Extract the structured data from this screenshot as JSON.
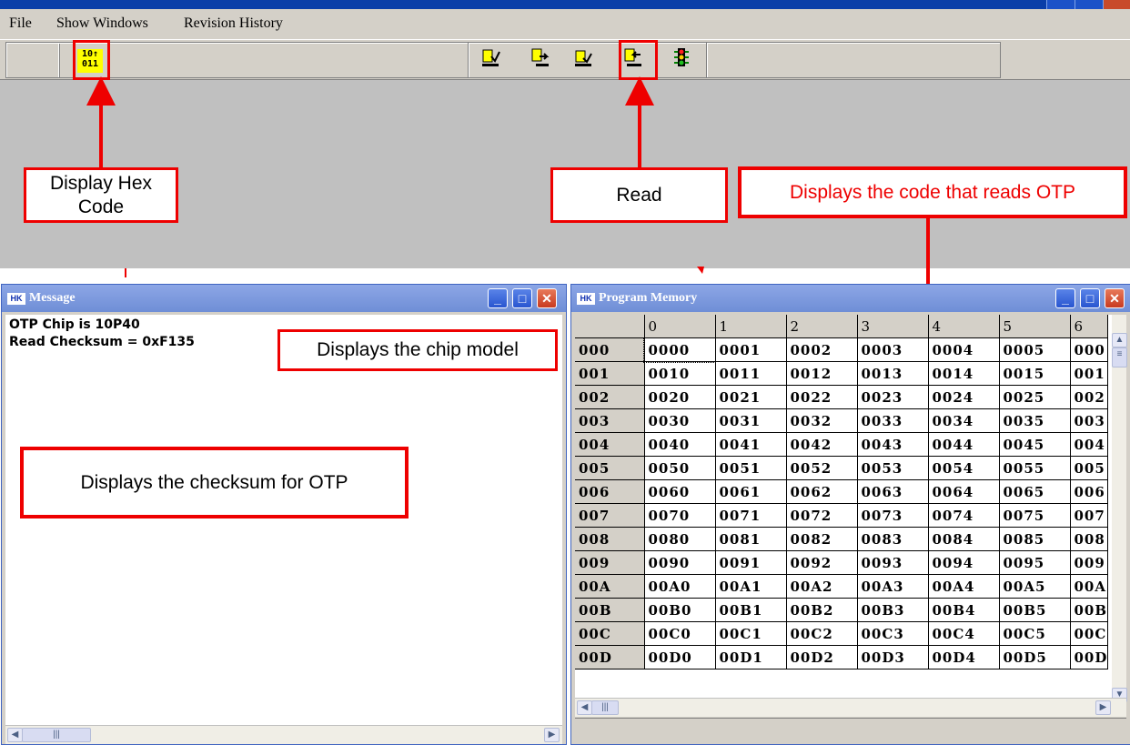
{
  "menu": {
    "file": "File",
    "show_windows": "Show Windows",
    "revision_history": "Revision History"
  },
  "toolbar": {
    "hex_icon_text": [
      "10↑",
      "011"
    ]
  },
  "annotations": {
    "display_hex_code": "Display Hex Code",
    "read": "Read",
    "reads_otp": "Displays the code that reads OTP",
    "chip_model": "Displays the chip model",
    "checksum": "Displays the checksum for OTP"
  },
  "message_window": {
    "title": "Message",
    "line1": "OTP Chip is 10P40",
    "line2": "Read Checksum = 0xF135"
  },
  "program_memory": {
    "title": "Program Memory",
    "columns": [
      "0",
      "1",
      "2",
      "3",
      "4",
      "5",
      "6"
    ],
    "rows": [
      {
        "addr": "000",
        "cells": [
          "0000",
          "0001",
          "0002",
          "0003",
          "0004",
          "0005",
          "000"
        ]
      },
      {
        "addr": "001",
        "cells": [
          "0010",
          "0011",
          "0012",
          "0013",
          "0014",
          "0015",
          "001"
        ]
      },
      {
        "addr": "002",
        "cells": [
          "0020",
          "0021",
          "0022",
          "0023",
          "0024",
          "0025",
          "002"
        ]
      },
      {
        "addr": "003",
        "cells": [
          "0030",
          "0031",
          "0032",
          "0033",
          "0034",
          "0035",
          "003"
        ]
      },
      {
        "addr": "004",
        "cells": [
          "0040",
          "0041",
          "0042",
          "0043",
          "0044",
          "0045",
          "004"
        ]
      },
      {
        "addr": "005",
        "cells": [
          "0050",
          "0051",
          "0052",
          "0053",
          "0054",
          "0055",
          "005"
        ]
      },
      {
        "addr": "006",
        "cells": [
          "0060",
          "0061",
          "0062",
          "0063",
          "0064",
          "0065",
          "006"
        ]
      },
      {
        "addr": "007",
        "cells": [
          "0070",
          "0071",
          "0072",
          "0073",
          "0074",
          "0075",
          "007"
        ]
      },
      {
        "addr": "008",
        "cells": [
          "0080",
          "0081",
          "0082",
          "0083",
          "0084",
          "0085",
          "008"
        ]
      },
      {
        "addr": "009",
        "cells": [
          "0090",
          "0091",
          "0092",
          "0093",
          "0094",
          "0095",
          "009"
        ]
      },
      {
        "addr": "00A",
        "cells": [
          "00A0",
          "00A1",
          "00A2",
          "00A3",
          "00A4",
          "00A5",
          "00A"
        ]
      },
      {
        "addr": "00B",
        "cells": [
          "00B0",
          "00B1",
          "00B2",
          "00B3",
          "00B4",
          "00B5",
          "00B"
        ]
      },
      {
        "addr": "00C",
        "cells": [
          "00C0",
          "00C1",
          "00C2",
          "00C3",
          "00C4",
          "00C5",
          "00C"
        ]
      },
      {
        "addr": "00D",
        "cells": [
          "00D0",
          "00D1",
          "00D2",
          "00D3",
          "00D4",
          "00D5",
          "00D"
        ]
      }
    ]
  },
  "colors": {
    "annotation_red": "#ee0000",
    "title_bar": "#7a96dc",
    "window_face": "#d4d0c8"
  }
}
